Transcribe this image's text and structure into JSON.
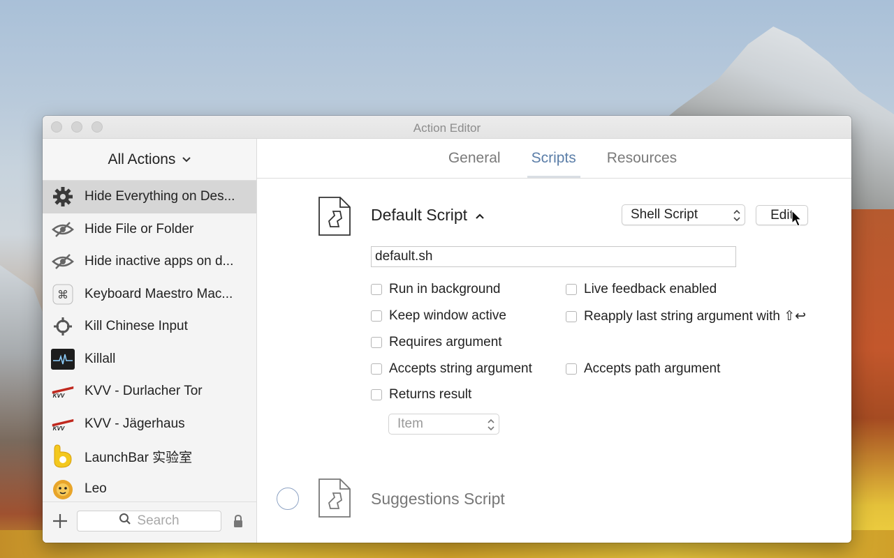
{
  "window": {
    "title": "Action Editor"
  },
  "sidebar": {
    "header": "All Actions",
    "items": [
      {
        "label": "Hide Everything on Des...",
        "icon": "gear-icon",
        "selected": true
      },
      {
        "label": "Hide File or Folder",
        "icon": "hidden-eye-icon"
      },
      {
        "label": "Hide inactive apps on d...",
        "icon": "hidden-eye-icon"
      },
      {
        "label": "Keyboard Maestro Mac...",
        "icon": "keyboard-maestro-icon"
      },
      {
        "label": "Kill Chinese Input",
        "icon": "crosshair-icon"
      },
      {
        "label": "Killall",
        "icon": "activity-monitor-icon"
      },
      {
        "label": "KVV - Durlacher Tor",
        "icon": "kvv-logo-icon"
      },
      {
        "label": "KVV - Jägerhaus",
        "icon": "kvv-logo-icon"
      },
      {
        "label": "LaunchBar 实验室",
        "icon": "launchbar-icon"
      },
      {
        "label": "Leo",
        "icon": "leo-icon"
      }
    ],
    "search_placeholder": "Search"
  },
  "tabs": [
    {
      "label": "General",
      "active": false
    },
    {
      "label": "Scripts",
      "active": true
    },
    {
      "label": "Resources",
      "active": false
    }
  ],
  "default_script": {
    "title": "Default Script",
    "type_select": "Shell Script",
    "edit_label": "Edit",
    "filename": "default.sh",
    "options": {
      "run_in_background": "Run in background",
      "live_feedback": "Live feedback enabled",
      "keep_window_active": "Keep window active",
      "reapply_last_string": "Reapply last string argument with ⇧↩",
      "requires_argument": "Requires argument",
      "accepts_string": "Accepts string argument",
      "accepts_path": "Accepts path argument",
      "returns_result": "Returns result"
    },
    "result_type": "Item"
  },
  "suggestions_script": {
    "title": "Suggestions Script"
  },
  "colors": {
    "accent": "#5b7ea8",
    "selection": "#d6d6d6"
  }
}
